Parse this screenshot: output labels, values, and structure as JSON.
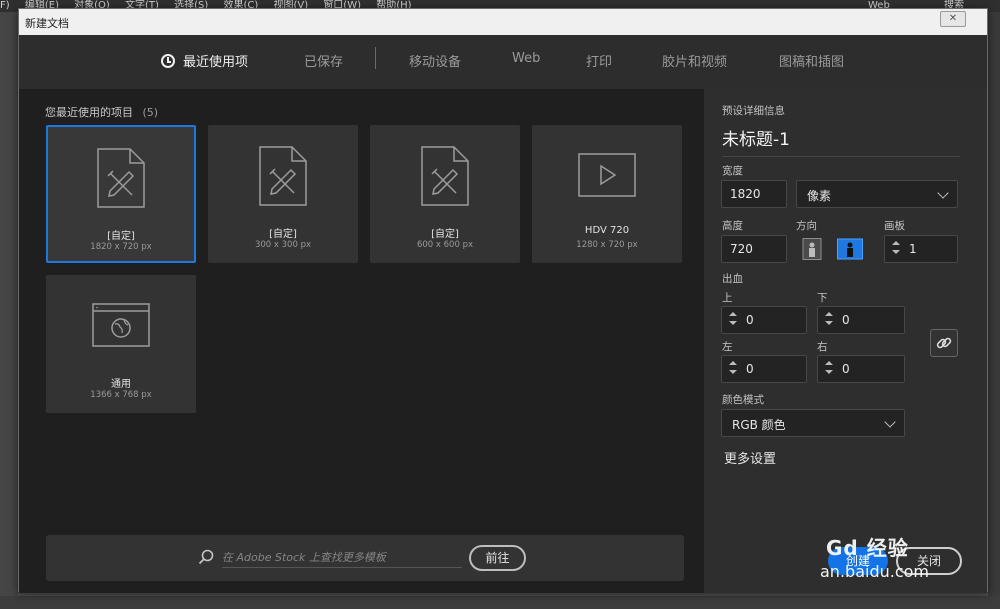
{
  "menubar": {
    "items": [
      "F)",
      "编辑(E)",
      "对象(O)",
      "文字(T)",
      "选择(S)",
      "效果(C)",
      "视图(V)",
      "窗口(W)",
      "帮助(H)"
    ],
    "workspace": "Web",
    "search": "搜索"
  },
  "dialog": {
    "title": "新建文档",
    "close_glyph": "✕"
  },
  "tabs": [
    {
      "label": "最近使用项",
      "active": true
    },
    {
      "label": "已保存"
    },
    {
      "label": "移动设备"
    },
    {
      "label": "Web"
    },
    {
      "label": "打印"
    },
    {
      "label": "胶片和视频"
    },
    {
      "label": "图稿和插图"
    }
  ],
  "recent": {
    "title": "您最近使用的项目",
    "count": "(5)",
    "presets": [
      {
        "name": "[自定]",
        "size": "1820 x 720 px",
        "icon": "document-pencil-icon",
        "selected": true
      },
      {
        "name": "[自定]",
        "size": "300 x 300 px",
        "icon": "document-pencil-icon"
      },
      {
        "name": "[自定]",
        "size": "600 x 600 px",
        "icon": "document-pencil-icon"
      },
      {
        "name": "HDV 720",
        "size": "1280 x 720 px",
        "icon": "video-play-icon"
      },
      {
        "name": "通用",
        "size": "1366 x 768 px",
        "icon": "web-browser-icon"
      }
    ]
  },
  "stock": {
    "placeholder": "在 Adobe Stock 上查找更多模板",
    "go_label": "前往"
  },
  "details": {
    "heading": "预设详细信息",
    "doc_name": "未标题-1",
    "width_label": "宽度",
    "width_value": "1820",
    "unit": "像素",
    "height_label": "高度",
    "height_value": "720",
    "orientation_label": "方向",
    "artboards_label": "画板",
    "artboards_value": "1",
    "bleed_label": "出血",
    "bleed_top_label": "上",
    "bleed_top": "0",
    "bleed_bottom_label": "下",
    "bleed_bottom": "0",
    "bleed_left_label": "左",
    "bleed_left": "0",
    "bleed_right_label": "右",
    "bleed_right": "0",
    "color_mode_label": "颜色模式",
    "color_mode": "RGB 颜色",
    "more_settings": "更多设置",
    "create_label": "创建",
    "close_label": "关闭"
  },
  "watermark": {
    "line1": "Gd 经验",
    "line2": "an.baidu.com"
  },
  "colors": {
    "accent": "#1473e6",
    "selected_border": "#1e78e0",
    "panel_bg": "#1f1f1f",
    "detail_bg": "#2e2e2e",
    "card_bg": "#333333"
  }
}
